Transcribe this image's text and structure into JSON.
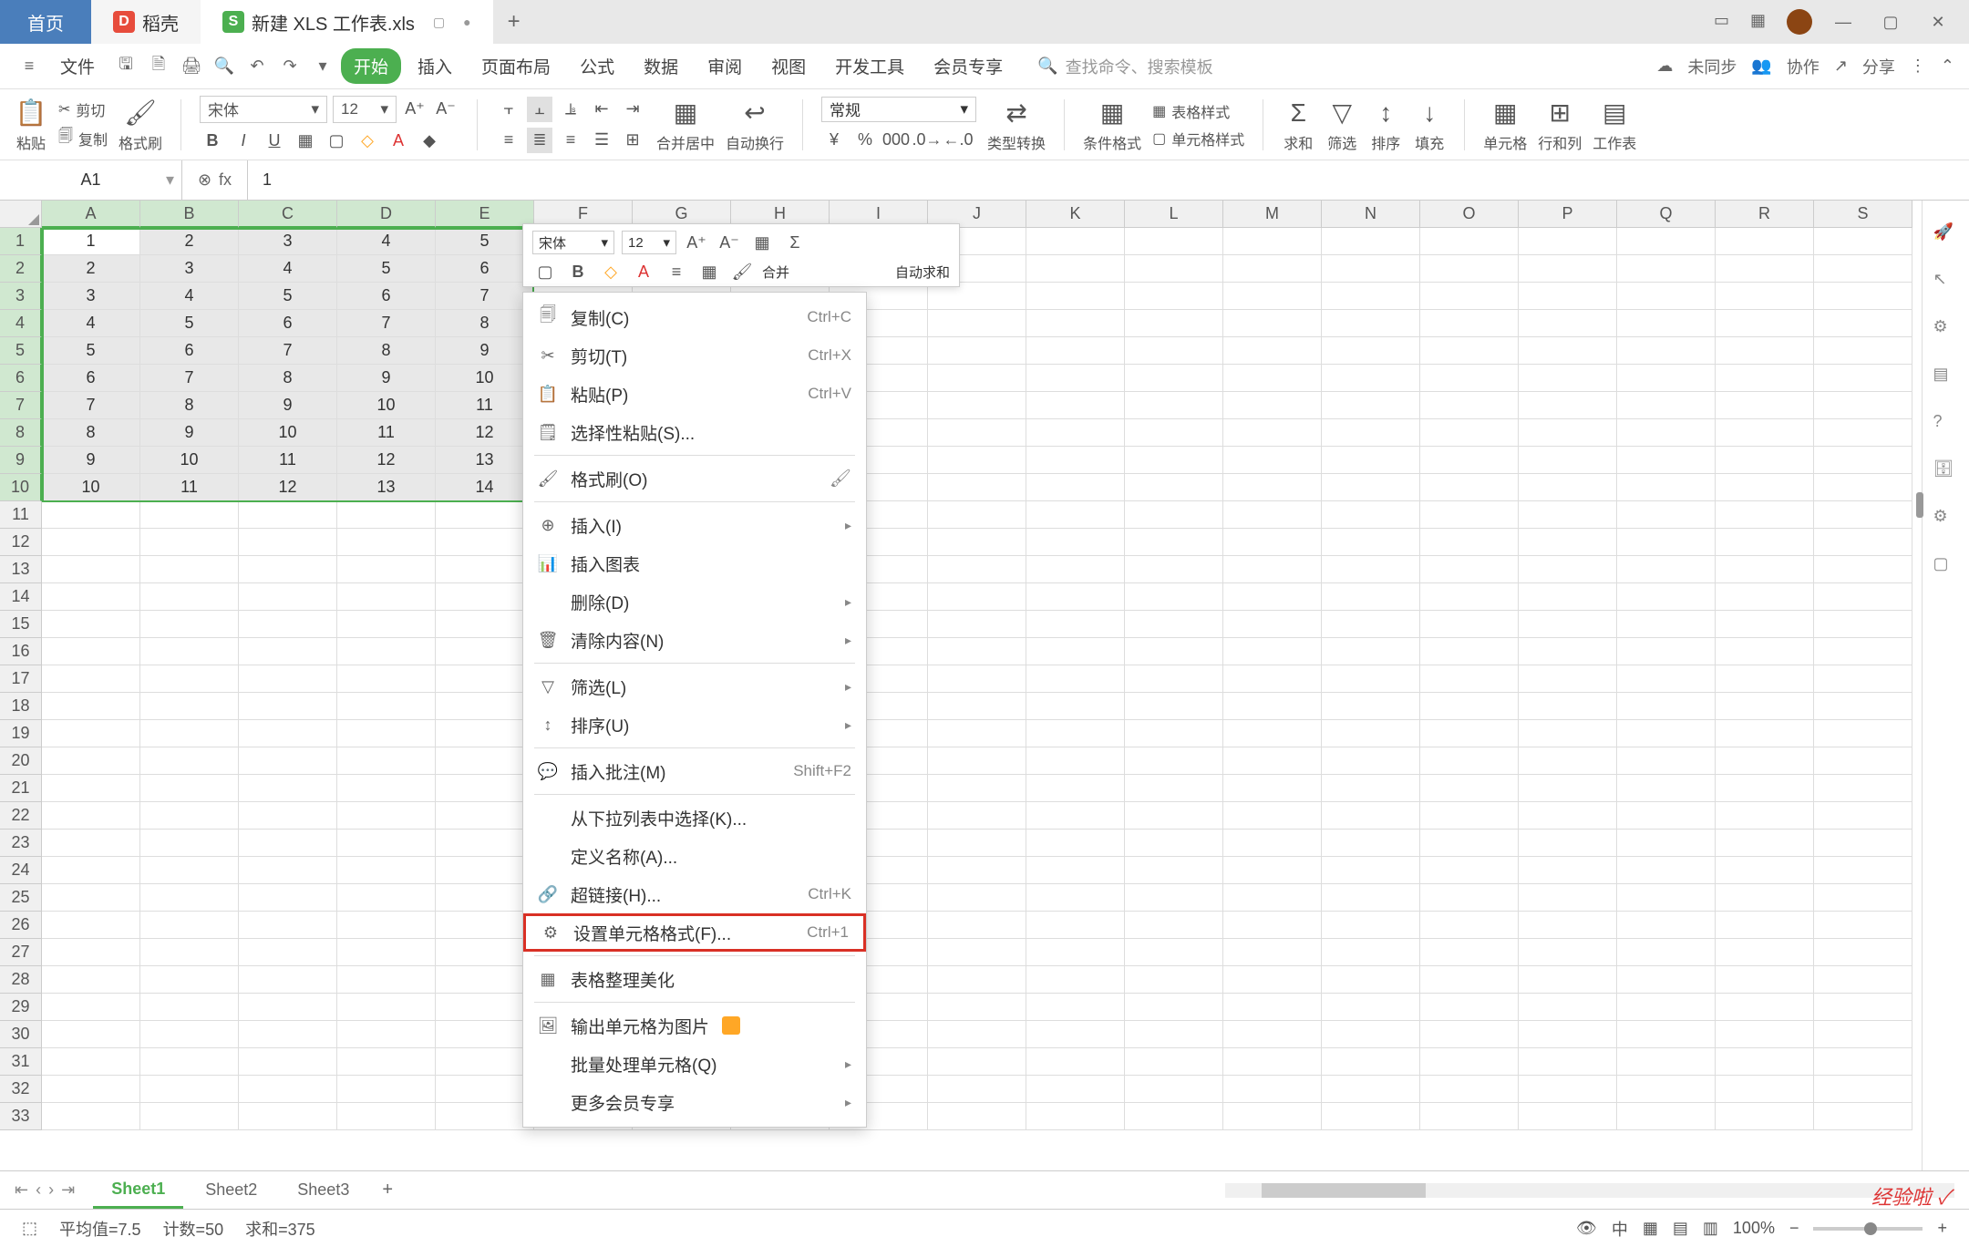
{
  "titlebar": {
    "home": "首页",
    "doc_tab": "稻壳",
    "active_tab": "新建 XLS 工作表.xls",
    "add": "+"
  },
  "menubar": {
    "file": "文件",
    "tabs": [
      "开始",
      "插入",
      "页面布局",
      "公式",
      "数据",
      "审阅",
      "视图",
      "开发工具",
      "会员专享"
    ],
    "search_placeholder": "查找命令、搜索模板",
    "unsync": "未同步",
    "collab": "协作",
    "share": "分享"
  },
  "ribbon": {
    "paste": "粘贴",
    "cut": "剪切",
    "copy": "复制",
    "format_painter": "格式刷",
    "font": "宋体",
    "font_size": "12",
    "merge_center": "合并居中",
    "wrap": "自动换行",
    "number_format": "常规",
    "type_convert": "类型转换",
    "cond_format": "条件格式",
    "table_style": "表格样式",
    "cell_style": "单元格样式",
    "sum": "求和",
    "filter": "筛选",
    "sort": "排序",
    "fill": "填充",
    "cells": "单元格",
    "rows_cols": "行和列",
    "worksheet": "工作表"
  },
  "formula_bar": {
    "name_box": "A1",
    "fx": "fx",
    "value": "1"
  },
  "columns": [
    "A",
    "B",
    "C",
    "D",
    "E",
    "F",
    "G",
    "H",
    "I",
    "J",
    "K",
    "L",
    "M",
    "N",
    "O",
    "P",
    "Q",
    "R",
    "S"
  ],
  "rows": 33,
  "chart_data": {
    "type": "table",
    "selection": "A1:E10",
    "data": [
      [
        1,
        2,
        3,
        4,
        5
      ],
      [
        2,
        3,
        4,
        5,
        6
      ],
      [
        3,
        4,
        5,
        6,
        7
      ],
      [
        4,
        5,
        6,
        7,
        8
      ],
      [
        5,
        6,
        7,
        8,
        9
      ],
      [
        6,
        7,
        8,
        9,
        10
      ],
      [
        7,
        8,
        9,
        10,
        11
      ],
      [
        8,
        9,
        10,
        11,
        12
      ],
      [
        9,
        10,
        11,
        12,
        13
      ],
      [
        10,
        11,
        12,
        13,
        14
      ]
    ]
  },
  "mini_toolbar": {
    "font": "宋体",
    "size": "12",
    "merge": "合并",
    "autosum": "自动求和"
  },
  "context_menu": {
    "copy": "复制(C)",
    "copy_sc": "Ctrl+C",
    "cut": "剪切(T)",
    "cut_sc": "Ctrl+X",
    "paste": "粘贴(P)",
    "paste_sc": "Ctrl+V",
    "paste_special": "选择性粘贴(S)...",
    "format_brush": "格式刷(O)",
    "insert": "插入(I)",
    "insert_chart": "插入图表",
    "delete": "删除(D)",
    "clear": "清除内容(N)",
    "filter": "筛选(L)",
    "sort": "排序(U)",
    "insert_comment": "插入批注(M)",
    "comment_sc": "Shift+F2",
    "from_dropdown": "从下拉列表中选择(K)...",
    "define_name": "定义名称(A)...",
    "hyperlink": "超链接(H)...",
    "hyperlink_sc": "Ctrl+K",
    "format_cells": "设置单元格格式(F)...",
    "format_cells_sc": "Ctrl+1",
    "table_beautify": "表格整理美化",
    "export_image": "输出单元格为图片",
    "batch": "批量处理单元格(Q)",
    "more_vip": "更多会员专享"
  },
  "sheets": {
    "list": [
      "Sheet1",
      "Sheet2",
      "Sheet3"
    ],
    "active": 0
  },
  "statusbar": {
    "avg_label": "平均值=7.5",
    "count_label": "计数=50",
    "sum_label": "求和=375",
    "zoom": "100%"
  },
  "watermark": "经验啦 ✓"
}
